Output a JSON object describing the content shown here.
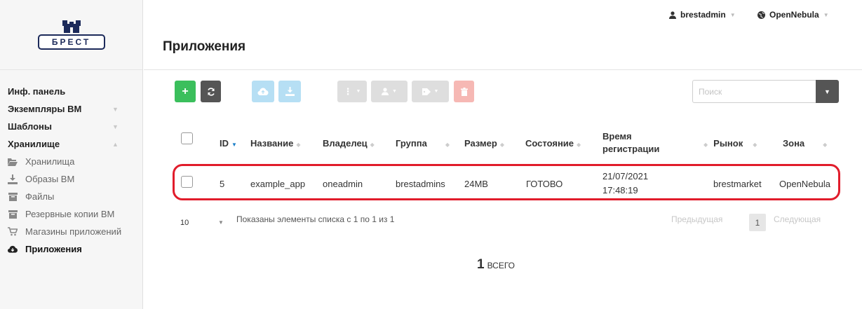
{
  "brand": {
    "logo_text": "БРЕСТ"
  },
  "sidebar": {
    "items": [
      {
        "label": "Инф. панель"
      },
      {
        "label": "Экземпляры ВМ"
      },
      {
        "label": "Шаблоны"
      },
      {
        "label": "Хранилище"
      }
    ],
    "storage_sub": [
      {
        "label": "Хранилища",
        "icon": "folder-open-icon"
      },
      {
        "label": "Образы ВМ",
        "icon": "download-icon"
      },
      {
        "label": "Файлы",
        "icon": "archive-icon"
      },
      {
        "label": "Резервные копии ВМ",
        "icon": "archive-icon"
      },
      {
        "label": "Магазины приложений",
        "icon": "shopping-cart-icon"
      },
      {
        "label": "Приложения",
        "icon": "cloud-icon",
        "active": true
      }
    ]
  },
  "header": {
    "title": "Приложения",
    "user": "brestadmin",
    "zone": "OpenNebula"
  },
  "toolbar": {
    "search_placeholder": "Поиск"
  },
  "table": {
    "columns": [
      "ID",
      "Название",
      "Владелец",
      "Группа",
      "Размер",
      "Состояние",
      "Время регистрации",
      "Рынок",
      "Зона"
    ],
    "rows": [
      {
        "id": "5",
        "name": "example_app",
        "owner": "oneadmin",
        "group": "brestadmins",
        "size": "24MB",
        "state": "ГОТОВО",
        "reg_date": "21/07/2021",
        "reg_time": "17:48:19",
        "market": "brestmarket",
        "zone": "OpenNebula"
      }
    ]
  },
  "footer": {
    "page_size": "10",
    "shown_text": "Показаны элементы списка с 1 по 1 из 1",
    "prev": "Предыдущая",
    "page": "1",
    "next": "Следующая",
    "total_count": "1",
    "total_label": "ВСЕГО"
  },
  "colors": {
    "create": "#3bbf5c",
    "dark": "#555555",
    "highlight": "#e11c2b",
    "sort_active": "#1a7ec8"
  }
}
